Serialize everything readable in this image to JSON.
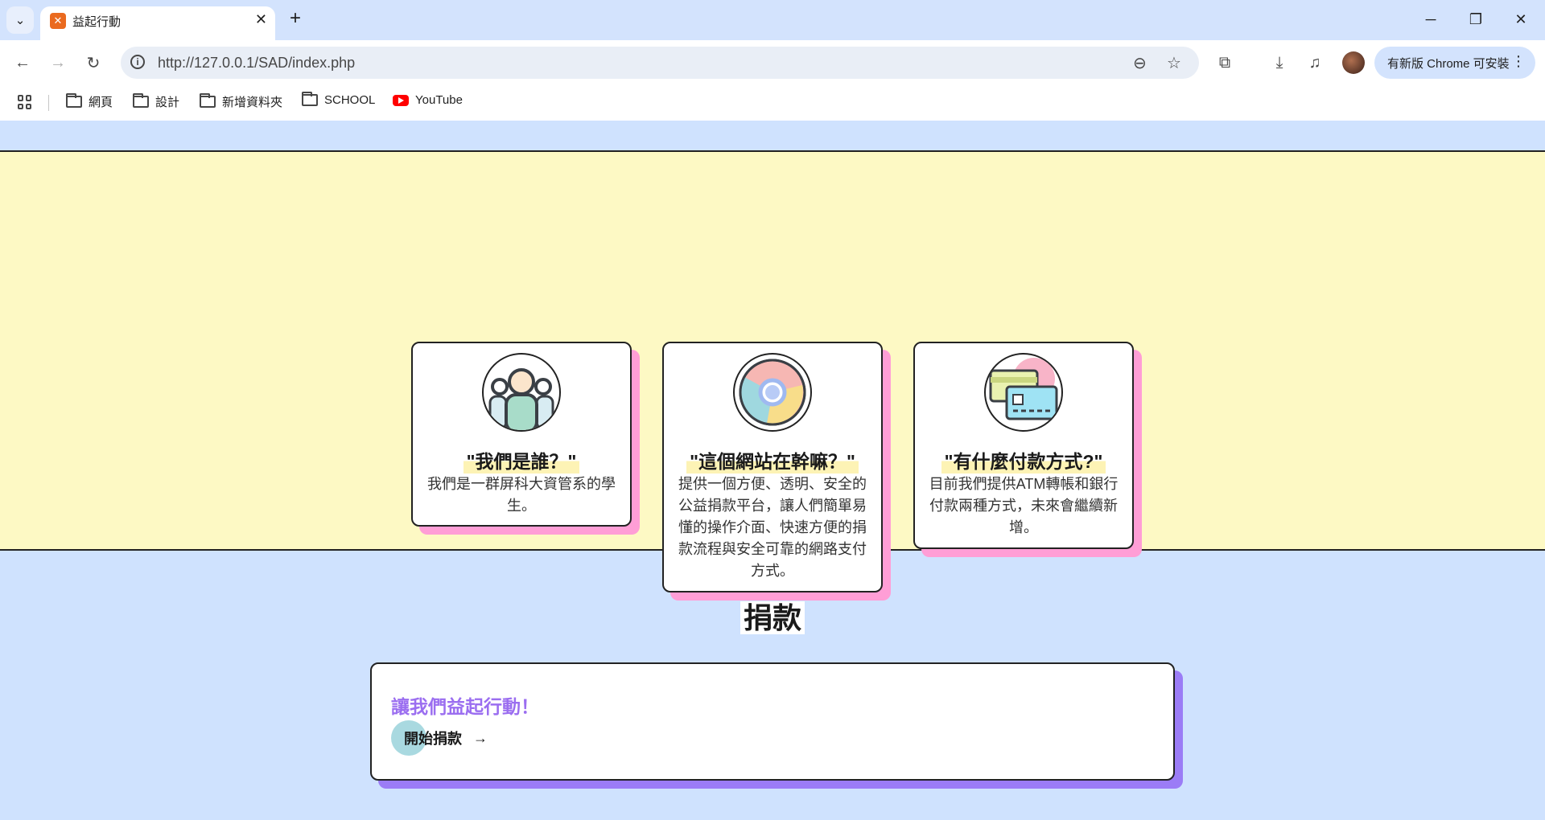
{
  "browser": {
    "tab_title": "益起行動",
    "url": "http://127.0.0.1/SAD/index.php",
    "update_button": "有新版 Chrome 可安裝",
    "bookmarks": [
      {
        "label": "網頁",
        "icon": "folder-icon"
      },
      {
        "label": "設計",
        "icon": "folder-icon"
      },
      {
        "label": "新增資料夾",
        "icon": "folder-icon"
      },
      {
        "label": "SCHOOL",
        "icon": "folder-icon"
      },
      {
        "label": "YouTube",
        "icon": "youtube-icon"
      }
    ]
  },
  "about": {
    "cards": [
      {
        "title": "\"我們是誰？\"",
        "body": "我們是一群屏科大資管系的學生。",
        "icon": "people-icon"
      },
      {
        "title": "\"這個網站在幹嘛？\"",
        "body": "提供一個方便、透明、安全的公益捐款平台，讓人們簡單易懂的操作介面、快速方便的捐款流程與安全可靠的網路支付方式。",
        "icon": "chrome-icon"
      },
      {
        "title": "\"有什麼付款方式?\"",
        "body": "目前我們提供ATM轉帳和銀行付款兩種方式，未來會繼續新增。",
        "icon": "credit-card-icon"
      }
    ]
  },
  "donate": {
    "section_title": "捐款",
    "heading": "讓我們益起行動！",
    "button_label": "開始捐款",
    "button_arrow": "→"
  },
  "colors": {
    "page_bg": "#cfe2fe",
    "yellow_band": "#fdf9c4",
    "card_shadow_pink": "#ff9ed6",
    "card_shadow_purple": "#9b7cf6",
    "heading_purple": "#9b6ef0"
  }
}
